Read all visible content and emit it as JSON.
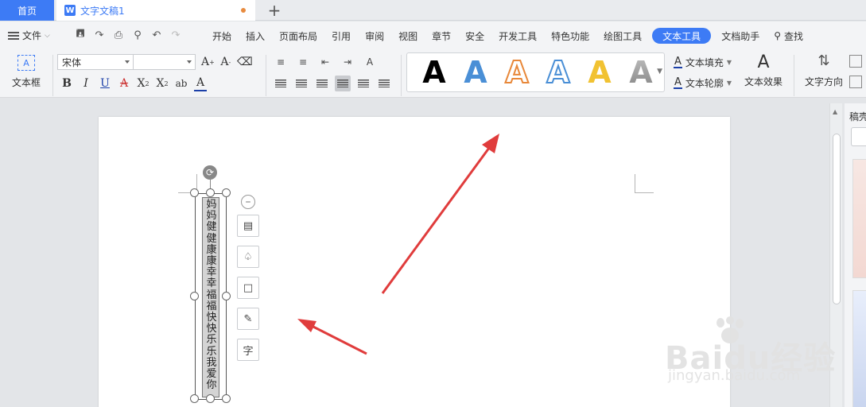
{
  "tabs": {
    "home": "首页",
    "doc_title": "文字文稿1"
  },
  "menu": {
    "file_label": "文件",
    "items": [
      "开始",
      "插入",
      "页面布局",
      "引用",
      "审阅",
      "视图",
      "章节",
      "安全",
      "开发工具",
      "特色功能",
      "绘图工具",
      "文本工具",
      "文档助手"
    ],
    "active_item": "文本工具",
    "search_label": "查找"
  },
  "ribbon": {
    "textbox_label": "文本框",
    "font_name": "宋体",
    "font_size": "",
    "text_fill_label": "文本填充",
    "text_outline_label": "文本轮廓",
    "text_effect_label": "文本效果",
    "text_direction_label": "文字方向",
    "style_samples": [
      {
        "glyph": "A",
        "color": "#000000",
        "variant": "solid"
      },
      {
        "glyph": "A",
        "color": "#4a8fd6",
        "variant": "solid"
      },
      {
        "glyph": "A",
        "color": "#e8883a",
        "variant": "outline"
      },
      {
        "glyph": "A",
        "color": "#4a8fd6",
        "variant": "outline"
      },
      {
        "glyph": "A",
        "color": "#f1c232",
        "variant": "solid"
      },
      {
        "glyph": "A",
        "color": "#888888",
        "variant": "gradient"
      }
    ]
  },
  "document": {
    "textbox_text": "妈妈健健康康幸幸福福快快乐乐我爱你"
  },
  "float_tools": [
    "layout-options-icon",
    "fill-icon",
    "outline-icon",
    "pen-icon",
    "font-icon"
  ],
  "float_tools_font_glyph": "字",
  "side_panel": {
    "title": "稿壳"
  },
  "watermark": {
    "main": "Baidu经验",
    "sub": "jingyan.baidu.com"
  },
  "colors": {
    "accent": "#3d7bf5",
    "arrow": "#e03c3c"
  }
}
